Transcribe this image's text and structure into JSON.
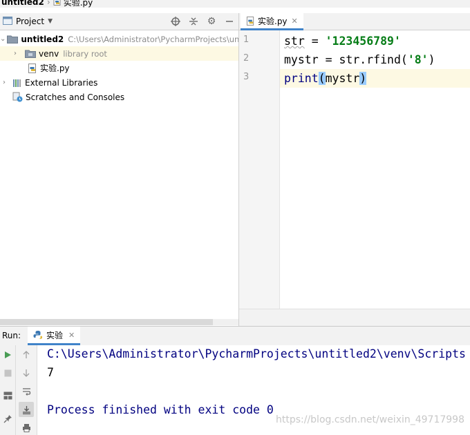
{
  "breadcrumb": {
    "project": "untitled2",
    "file": "实验.py"
  },
  "project_panel": {
    "title": "Project",
    "tools": [
      "target-icon",
      "collapse-icon",
      "gear-icon",
      "minimize-icon"
    ],
    "tree": [
      {
        "name": "untitled2",
        "hint": "C:\\Users\\Administrator\\PycharmProjects\\un",
        "icon": "folder-icon"
      },
      {
        "name": "venv",
        "hint": "library root",
        "icon": "folder-icon"
      },
      {
        "name": "实验.py",
        "icon": "python-file-icon"
      },
      {
        "name": "External Libraries",
        "icon": "library-icon"
      },
      {
        "name": "Scratches and Consoles",
        "icon": "scratches-icon"
      }
    ]
  },
  "editor": {
    "tab_label": "实验.py",
    "line_numbers": [
      "1",
      "2",
      "3"
    ],
    "lines": [
      {
        "p1": "str",
        "p2": " = ",
        "p3": "'123456789'"
      },
      {
        "p1": "mystr = str.rfind(",
        "p2": "'8'",
        "p3": ")"
      },
      {
        "p1": "print",
        "p2": "(",
        "p3": "mystr",
        "p4": ")"
      }
    ]
  },
  "run_panel": {
    "label": "Run:",
    "tab_label": "实验",
    "console_lines": [
      "C:\\Users\\Administrator\\PycharmProjects\\untitled2\\venv\\Scripts",
      "7",
      "",
      "Process finished with exit code 0"
    ],
    "watermark": "https://blog.csdn.net/weixin_49717998"
  },
  "colors": {
    "accent": "#4083c9",
    "string": "#067d17",
    "builtin": "#000080",
    "current_line": "#fdf9e3"
  }
}
